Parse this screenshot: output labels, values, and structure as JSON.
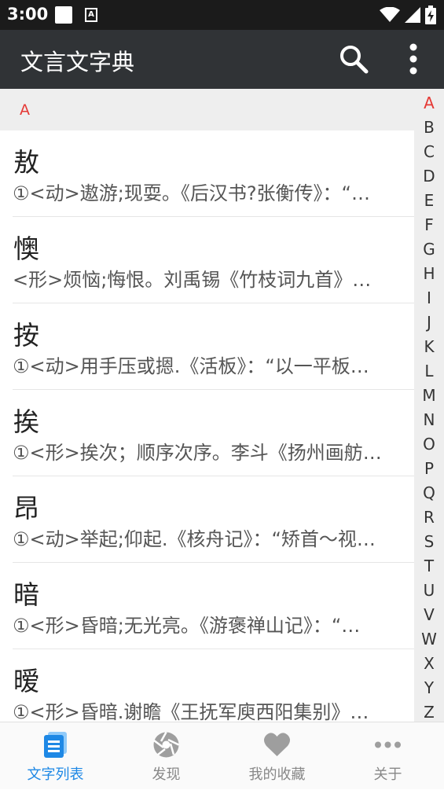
{
  "status_bar": {
    "time": "3:00",
    "notification_icon_letter": "A"
  },
  "app_bar": {
    "title": "文言文字典",
    "search_icon": "search-icon",
    "more_icon": "more-vert-icon"
  },
  "section": {
    "letter": "A"
  },
  "entries": [
    {
      "char": "敖",
      "definition": "①<动>遨游;现耍。《后汉书?张衡传》：“…"
    },
    {
      "char": "懊",
      "definition": "<形>烦恼;悔恨。刘禹锡《竹枝词九首》…"
    },
    {
      "char": "按",
      "definition": "①<动>用手压或摁.《活板》：“以一平板…"
    },
    {
      "char": "挨",
      "definition": "①<形>挨次；顺序次序。李斗《扬州画舫…"
    },
    {
      "char": "昂",
      "definition": "①<动>举起;仰起.《核舟记》：“矫首～视…"
    },
    {
      "char": "暗",
      "definition": "①<形>昏暗;无光亮。《游褒禅山记》：“…"
    },
    {
      "char": "暧",
      "definition": "①<形>昏暗.谢瞻《王抚军庾西阳集别》…"
    }
  ],
  "index_letters": [
    "A",
    "B",
    "C",
    "D",
    "E",
    "F",
    "G",
    "H",
    "I",
    "J",
    "K",
    "L",
    "M",
    "N",
    "O",
    "P",
    "Q",
    "R",
    "S",
    "T",
    "U",
    "V",
    "W",
    "X",
    "Y",
    "Z"
  ],
  "active_index_letter": "A",
  "bottom_nav": [
    {
      "label": "文字列表",
      "icon": "list-icon",
      "active": true
    },
    {
      "label": "发现",
      "icon": "aperture-icon",
      "active": false
    },
    {
      "label": "我的收藏",
      "icon": "heart-icon",
      "active": false
    },
    {
      "label": "关于",
      "icon": "more-horiz-icon",
      "active": false
    }
  ],
  "colors": {
    "app_bar": "#303336",
    "accent_red": "#e53935",
    "nav_active": "#1e88e5",
    "nav_inactive": "#999999"
  }
}
